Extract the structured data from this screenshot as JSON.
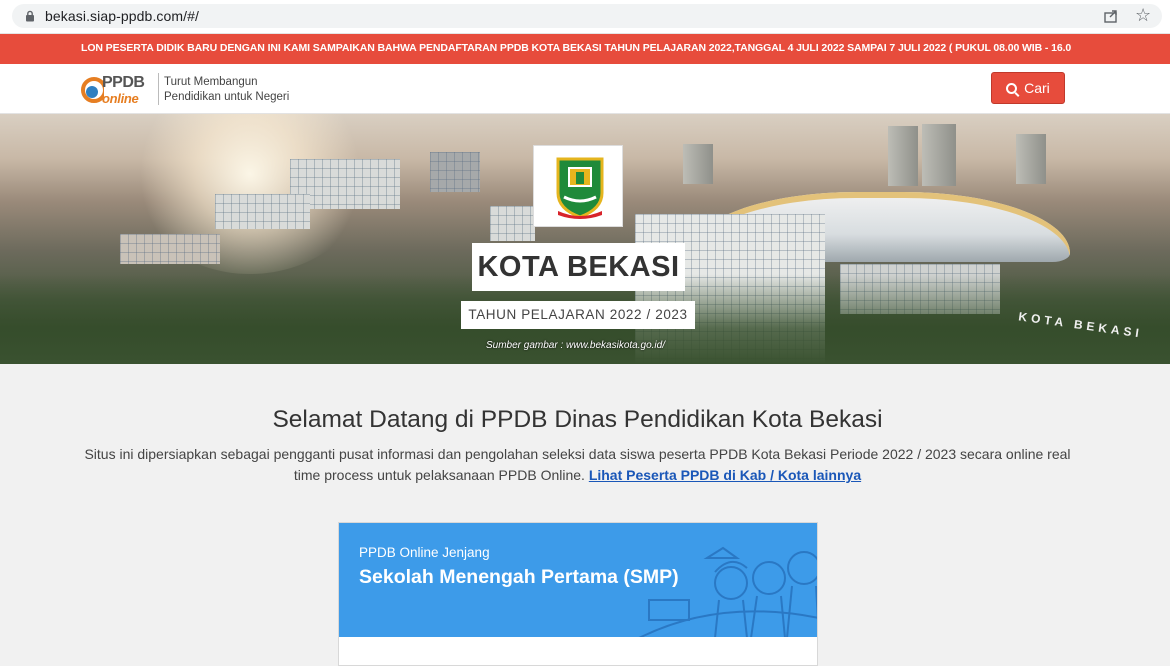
{
  "browser": {
    "url": "bekasi.siap-ppdb.com/#/"
  },
  "marquee": {
    "text": "LON PESERTA DIDIK BARU DENGAN INI KAMI SAMPAIKAN BAHWA PENDAFTARAN PPDB KOTA BEKASI TAHUN PELAJARAN 2022,TANGGAL 4 JULI 2022 SAMPAI 7 JULI 2022 ( PUKUL 08.00 WIB - 16.0"
  },
  "header": {
    "logo_ppdb": "PPDB",
    "logo_online": "online",
    "tagline_line1": "Turut Membangun",
    "tagline_line2": "Pendidikan untuk Negeri",
    "search_label": "Cari"
  },
  "hero": {
    "city_name": "KOTA BEKASI",
    "school_year": "TAHUN PELAJARAN 2022 / 2023",
    "image_source": "Sumber gambar : www.bekasikota.go.id/",
    "watermark": "KOTA BEKASI"
  },
  "welcome": {
    "title": "Selamat Datang di PPDB Dinas Pendidikan Kota Bekasi",
    "description": "Situs ini dipersiapkan sebagai pengganti pusat informasi dan pengolahan seleksi data siswa peserta PPDB Kota Bekasi Periode 2022 / 2023 secara online real time process untuk pelaksanaan PPDB Online.",
    "link_label": "Lihat Peserta PPDB di Kab / Kota lainnya"
  },
  "card": {
    "subtitle": "PPDB Online Jenjang",
    "title": "Sekolah Menengah Pertama (SMP)"
  },
  "colors": {
    "accent_red": "#e74c3c",
    "card_blue": "#3d9be9",
    "link_blue": "#1a57b8"
  }
}
